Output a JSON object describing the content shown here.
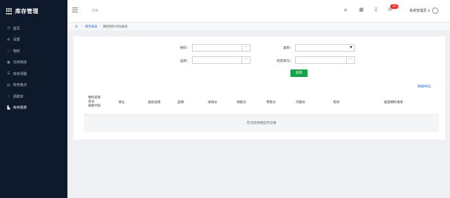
{
  "brand": {
    "title": "库存管理"
  },
  "sidebar": {
    "items": [
      {
        "label": "首页",
        "icon": "home-icon",
        "glyph": "◷",
        "active": false
      },
      {
        "label": "设置",
        "icon": "gear-icon",
        "glyph": "⚙",
        "active": false
      },
      {
        "label": "物料",
        "icon": "box-icon",
        "glyph": "◌",
        "active": false
      },
      {
        "label": "仓库库房",
        "icon": "warehouse-icon",
        "glyph": "▣",
        "active": false
      },
      {
        "label": "库存调整",
        "icon": "adjust-icon",
        "glyph": "☰",
        "active": false
      },
      {
        "label": "库存盘点",
        "icon": "clipboard-icon",
        "glyph": "▤",
        "active": false
      },
      {
        "label": "调拨单",
        "icon": "transfer-icon",
        "glyph": "☆",
        "active": false
      },
      {
        "label": "库存报表",
        "icon": "chart-icon",
        "glyph": "▙",
        "active": true
      }
    ]
  },
  "topbar": {
    "search_placeholder": "搜索...",
    "notification_count": "10",
    "user_name": "系统管理员"
  },
  "breadcrumb": {
    "items": [
      "库存报表",
      "期初物料评估报表"
    ]
  },
  "filters": {
    "material_label": "物料：",
    "category_label": "类别：",
    "brand_label": "品牌：",
    "unit_label": "经营单元：",
    "picker_dots": "···",
    "query_button": "查询",
    "export_link": "数据导出"
  },
  "table": {
    "columns": [
      {
        "lines": [
          "物料名称",
          "货号",
          "规格代码"
        ]
      },
      {
        "lines": [
          "单位"
        ]
      },
      {
        "lines": [
          "类别名称"
        ]
      },
      {
        "lines": [
          "品牌"
        ]
      },
      {
        "lines": [
          "采购价"
        ]
      },
      {
        "lines": [
          "销售价"
        ]
      },
      {
        "lines": [
          "零售价"
        ]
      },
      {
        "lines": [
          "内部价"
        ]
      },
      {
        "lines": [
          "有效"
        ]
      },
      {
        "lines": [
          "组成物料清单"
        ]
      }
    ],
    "empty_text": "无法找到相应的记录"
  },
  "colors": {
    "sidebar_bg": "#0e1a2b",
    "accent_green": "#1aa34a",
    "link_blue": "#2d6fd6",
    "badge_red": "#e33333"
  }
}
